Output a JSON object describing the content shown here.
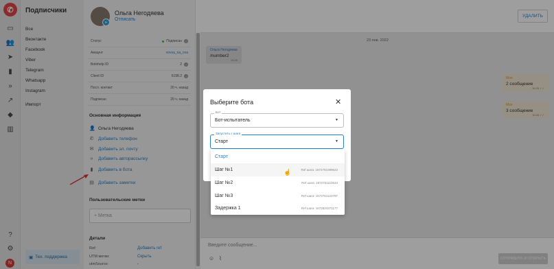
{
  "rail": {
    "logo": "✆",
    "user_initial": "N"
  },
  "sidebar": {
    "title": "Подписчики",
    "items": [
      "Все",
      "Вконтакте",
      "Facebook",
      "Viber",
      "Telegram",
      "Whatsapp",
      "Instagram",
      "Импорт"
    ],
    "support_label": "Тех. поддержка"
  },
  "contact": {
    "name": "Ольга Негодяева",
    "unsubscribe": "Отписать"
  },
  "props": [
    {
      "label": "Статус",
      "value": "Подписан"
    },
    {
      "label": "Аккаунт",
      "value": "vovsa_na_ova"
    },
    {
      "label": "Botnhelp ID",
      "value": "2"
    },
    {
      "label": "Client ID",
      "value": "6198.2"
    },
    {
      "label": "Посл. контакт",
      "value": "20 ч. назад"
    },
    {
      "label": "Подписан",
      "value": "20 ч. назад"
    }
  ],
  "main_info": {
    "title": "Основная информация",
    "name": "Ольга Негодяева",
    "add_phone": "Добавить телефон",
    "add_email": "Добавить эл. почту",
    "add_autorsend": "Добавить авторассылку",
    "add_bot": "Добавить в бота",
    "add_notes": "Добавить заметки"
  },
  "tags": {
    "title": "Пользовательские метки",
    "placeholder": "+ Метка"
  },
  "details": {
    "title": "Детали",
    "ref_label": "Ref:",
    "ref_value": "Добавить ref",
    "utm_label": "UTM метки:",
    "utm_value": "Скрыть",
    "source_label": "utmSource:",
    "source_value": "-"
  },
  "header": {
    "delete_button": "УДАЛИТЬ"
  },
  "chat": {
    "date": "23 янв. 2022",
    "messages": [
      {
        "sender": "Ольга Негодяева",
        "text": "/number2",
        "time": "16:25"
      },
      {
        "sender": "Мое",
        "text": "2 сообщение",
        "time": "16:25"
      },
      {
        "sender": "Мое",
        "text": "3 сообщение",
        "time": "16:25"
      }
    ],
    "input_placeholder": "Введите сообщение...",
    "send_button": "ОТПРАВИТЬ И ОТКРЫТЬ"
  },
  "modal": {
    "title": "Выберите бота",
    "bot_label": "Бот",
    "bot_value": "Бот-испытатель",
    "step_label": "Запустить с шага",
    "step_value": "Старт",
    "options": [
      {
        "label": "Старт",
        "ref": ""
      },
      {
        "label": "Шаг №1",
        "ref": "Ref шага: 1672751089522"
      },
      {
        "label": "Шаг №2",
        "ref": "Ref шага: 1672751110534"
      },
      {
        "label": "Шаг №3",
        "ref": "Ref шага: 1672751123797"
      },
      {
        "label": "Задержка 1",
        "ref": "Ref шага: 1672824371177"
      }
    ]
  },
  "colors": {
    "accent": "#2a7fc4",
    "brand": "#e04646",
    "annotation": "#e03030"
  }
}
